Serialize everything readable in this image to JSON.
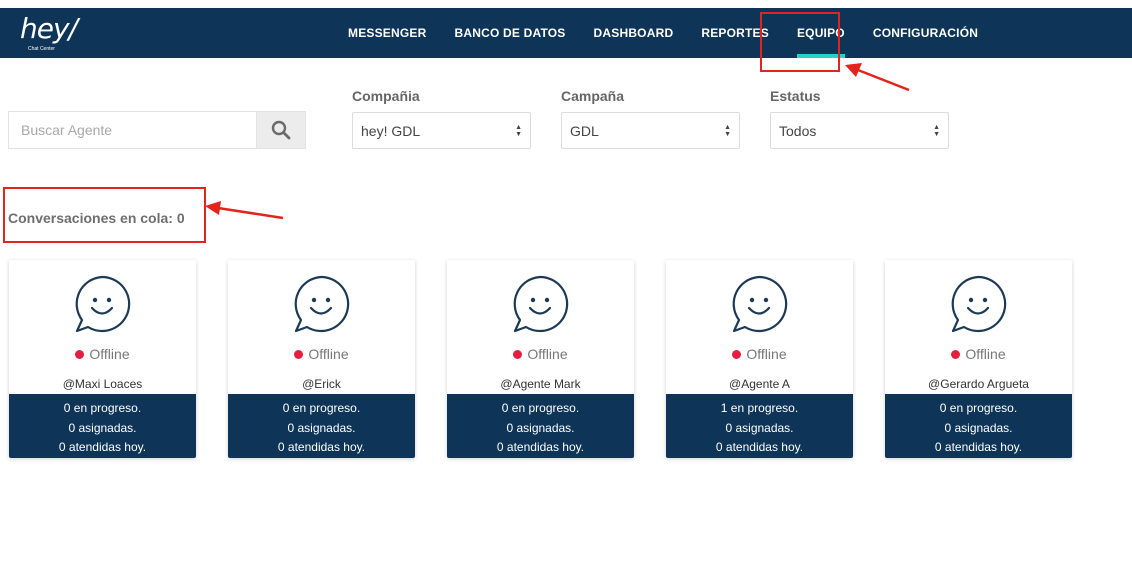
{
  "logo": {
    "main": "hey/",
    "sub": "Chat Center"
  },
  "nav": {
    "items": [
      {
        "label": "MESSENGER"
      },
      {
        "label": "BANCO DE DATOS"
      },
      {
        "label": "DASHBOARD"
      },
      {
        "label": "REPORTES"
      },
      {
        "label": "EQUIPO"
      },
      {
        "label": "CONFIGURACIÓN"
      }
    ],
    "active_accent": "#23d3c3",
    "background": "#0e3558"
  },
  "search": {
    "placeholder": "Buscar Agente",
    "icon": "search-icon"
  },
  "filters": {
    "compania": {
      "label": "Compañia",
      "value": "hey! GDL"
    },
    "campana": {
      "label": "Campaña",
      "value": "GDL"
    },
    "estatus": {
      "label": "Estatus",
      "value": "Todos"
    }
  },
  "queue": {
    "text": "Conversaciones en cola: 0"
  },
  "agents": [
    {
      "status": "Offline",
      "name": "@Maxi Loaces",
      "in_progress": "0 en progreso.",
      "assigned": "0 asignadas.",
      "attended": "0 atendidas hoy."
    },
    {
      "status": "Offline",
      "name": "@Erick",
      "in_progress": "0 en progreso.",
      "assigned": "0 asignadas.",
      "attended": "0 atendidas hoy."
    },
    {
      "status": "Offline",
      "name": "@Agente Mark",
      "in_progress": "0 en progreso.",
      "assigned": "0 asignadas.",
      "attended": "0 atendidas hoy."
    },
    {
      "status": "Offline",
      "name": "@Agente A",
      "in_progress": "1 en progreso.",
      "assigned": "0 asignadas.",
      "attended": "0 atendidas hoy."
    },
    {
      "status": "Offline",
      "name": "@Gerardo Argueta",
      "in_progress": "0 en progreso.",
      "assigned": "0 asignadas.",
      "attended": "0 atendidas hoy."
    }
  ],
  "colors": {
    "offline_dot": "#e41e3f",
    "annotation": "#e3241c"
  }
}
